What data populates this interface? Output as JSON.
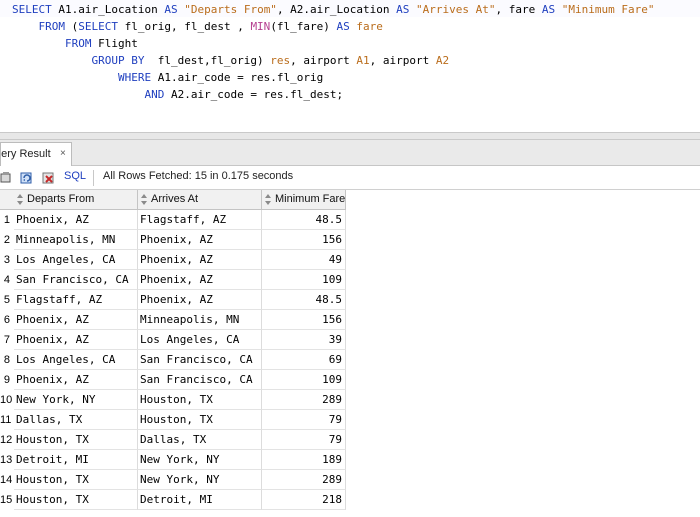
{
  "editor": {
    "lines": [
      [
        {
          "t": "SELECT",
          "c": "kw"
        },
        {
          "t": " A1.air_Location ",
          "c": ""
        },
        {
          "t": "AS",
          "c": "kw"
        },
        {
          "t": " ",
          "c": ""
        },
        {
          "t": "\"Departs From\"",
          "c": "str"
        },
        {
          "t": ", A2.air_Location ",
          "c": ""
        },
        {
          "t": "AS",
          "c": "kw"
        },
        {
          "t": " ",
          "c": ""
        },
        {
          "t": "\"Arrives At\"",
          "c": "str"
        },
        {
          "t": ", fare ",
          "c": ""
        },
        {
          "t": "AS",
          "c": "kw"
        },
        {
          "t": " ",
          "c": ""
        },
        {
          "t": "\"Minimum Fare\"",
          "c": "str"
        }
      ],
      [
        {
          "t": "    FROM",
          "c": "kw"
        },
        {
          "t": " (",
          "c": ""
        },
        {
          "t": "SELECT",
          "c": "kw"
        },
        {
          "t": " fl_orig, fl_dest , ",
          "c": ""
        },
        {
          "t": "MIN",
          "c": "fn"
        },
        {
          "t": "(fl_fare) ",
          "c": ""
        },
        {
          "t": "AS",
          "c": "kw"
        },
        {
          "t": " ",
          "c": ""
        },
        {
          "t": "fare",
          "c": "str"
        }
      ],
      [
        {
          "t": "        FROM",
          "c": "kw"
        },
        {
          "t": " Flight",
          "c": ""
        }
      ],
      [
        {
          "t": "            GROUP BY",
          "c": "kw"
        },
        {
          "t": "  fl_dest,fl_orig) ",
          "c": ""
        },
        {
          "t": "res",
          "c": "str"
        },
        {
          "t": ", airport ",
          "c": ""
        },
        {
          "t": "A1",
          "c": "str"
        },
        {
          "t": ", airport ",
          "c": ""
        },
        {
          "t": "A2",
          "c": "str"
        }
      ],
      [
        {
          "t": "                WHERE",
          "c": "kw"
        },
        {
          "t": " A1.air_code = res.fl_orig",
          "c": ""
        }
      ],
      [
        {
          "t": "                    AND",
          "c": "kw"
        },
        {
          "t": " A2.air_code = res.fl_dest;",
          "c": ""
        }
      ]
    ]
  },
  "result_tab": {
    "label": "uery Result",
    "close": "×"
  },
  "toolbar": {
    "sql_label": "SQL",
    "status": "All Rows Fetched: 15 in 0.175 seconds"
  },
  "columns": [
    "Departs From",
    "Arrives At",
    "Minimum Fare"
  ],
  "rows": [
    {
      "n": "1",
      "from": "Phoenix, AZ",
      "to": "Flagstaff, AZ",
      "fare": "48.5"
    },
    {
      "n": "2",
      "from": "Minneapolis, MN",
      "to": "Phoenix, AZ",
      "fare": "156"
    },
    {
      "n": "3",
      "from": "Los Angeles, CA",
      "to": "Phoenix, AZ",
      "fare": "49"
    },
    {
      "n": "4",
      "from": "San Francisco, CA",
      "to": "Phoenix, AZ",
      "fare": "109"
    },
    {
      "n": "5",
      "from": "Flagstaff, AZ",
      "to": "Phoenix, AZ",
      "fare": "48.5"
    },
    {
      "n": "6",
      "from": "Phoenix, AZ",
      "to": "Minneapolis, MN",
      "fare": "156"
    },
    {
      "n": "7",
      "from": "Phoenix, AZ",
      "to": "Los Angeles, CA",
      "fare": "39"
    },
    {
      "n": "8",
      "from": "Los Angeles, CA",
      "to": "San Francisco, CA",
      "fare": "69"
    },
    {
      "n": "9",
      "from": "Phoenix, AZ",
      "to": "San Francisco, CA",
      "fare": "109"
    },
    {
      "n": "10",
      "from": "New York, NY",
      "to": "Houston, TX",
      "fare": "289"
    },
    {
      "n": "11",
      "from": "Dallas, TX",
      "to": "Houston, TX",
      "fare": "79"
    },
    {
      "n": "12",
      "from": "Houston, TX",
      "to": "Dallas, TX",
      "fare": "79"
    },
    {
      "n": "13",
      "from": "Detroit, MI",
      "to": "New York, NY",
      "fare": "189"
    },
    {
      "n": "14",
      "from": "Houston, TX",
      "to": "New York, NY",
      "fare": "289"
    },
    {
      "n": "15",
      "from": "Houston, TX",
      "to": "Detroit, MI",
      "fare": "218"
    }
  ],
  "icons": [
    "pin-icon",
    "refresh-query-icon",
    "cancel-query-icon"
  ]
}
